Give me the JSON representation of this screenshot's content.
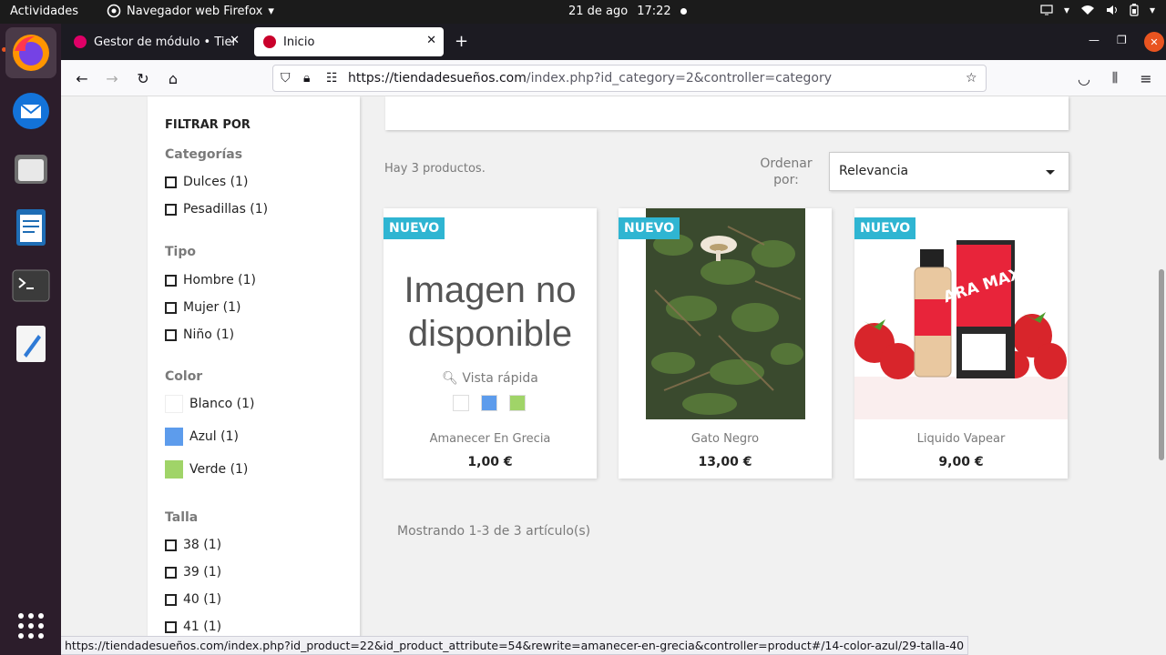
{
  "topbar": {
    "activities": "Actividades",
    "app_name": "Navegador web Firefox",
    "date": "21 de ago",
    "time": "17:22"
  },
  "tabs": [
    {
      "label": "Gestor de módulo • Tiend",
      "active": false
    },
    {
      "label": "Inicio",
      "active": true
    }
  ],
  "urlbar": {
    "url_host": "https://tiendadesueños.com",
    "url_path": "/index.php?id_category=2&controller=category"
  },
  "filters": {
    "title": "FILTRAR POR",
    "categorias_title": "Categorías",
    "categorias": [
      "Dulces (1)",
      "Pesadillas (1)"
    ],
    "tipo_title": "Tipo",
    "tipo": [
      "Hombre (1)",
      "Mujer (1)",
      "Niño (1)"
    ],
    "color_title": "Color",
    "colores": [
      {
        "label": "Blanco (1)",
        "color": "#ffffff"
      },
      {
        "label": "Azul (1)",
        "color": "#5d9cec"
      },
      {
        "label": "Verde (1)",
        "color": "#a0d468"
      }
    ],
    "talla_title": "Talla",
    "tallas": [
      "38 (1)",
      "39 (1)",
      "40 (1)",
      "41 (1)"
    ]
  },
  "listing": {
    "count": "Hay 3 productos.",
    "sort_label": "Ordenar por:",
    "sort_value": "Relevancia",
    "showing": "Mostrando 1-3 de 3 artículo(s)"
  },
  "products": [
    {
      "badge": "NUEVO",
      "name": "Amanecer En Grecia",
      "price": "1,00 €",
      "noimg_line1": "Imagen no",
      "noimg_line2": "disponible",
      "quick_view": "Vista rápida"
    },
    {
      "badge": "NUEVO",
      "name": "Gato Negro",
      "price": "13,00 €"
    },
    {
      "badge": "NUEVO",
      "name": "Liquido Vapear",
      "price": "9,00 €",
      "box_text": "ARA MAX"
    }
  ],
  "status_url": "https://tiendadesueños.com/index.php?id_product=22&id_product_attribute=54&rewrite=amanecer-en-grecia&controller=product#/14-color-azul/29-talla-40",
  "colors": {
    "accent": "#2fb5d2",
    "ubuntu_orange": "#e95420"
  }
}
